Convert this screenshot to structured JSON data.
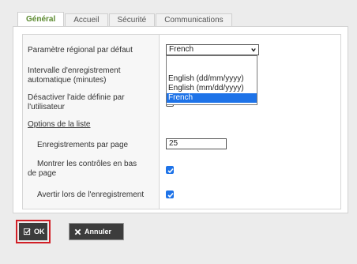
{
  "tabs": [
    {
      "label": "Général",
      "active": true
    },
    {
      "label": "Accueil",
      "active": false
    },
    {
      "label": "Sécurité",
      "active": false
    },
    {
      "label": "Communications",
      "active": false
    }
  ],
  "form": {
    "locale": {
      "label": "Paramètre régional par défaut",
      "value": "French",
      "options": [
        "English (dd/mm/yyyy)",
        "English (mm/dd/yyyy)",
        "French"
      ],
      "selected_option": "French"
    },
    "autosave": {
      "label_line1": "Intervalle d'enregistrement",
      "label_line2": "automatique (minutes)"
    },
    "disable_help": {
      "label_line1": "Désactiver l'aide définie par",
      "label_line2": "l'utilisateur",
      "checked": false
    },
    "list_options": {
      "title": "Options de la liste",
      "records_per_page": {
        "label": "Enregistrements par page",
        "value": "25"
      },
      "show_controls": {
        "label_line1": "Montrer les contrôles en bas",
        "label_line2": "de page",
        "checked": true
      },
      "warn_on_save": {
        "label": "Avertir lors de l'enregistrement",
        "checked": true
      }
    }
  },
  "buttons": {
    "ok": "OK",
    "cancel": "Annuler"
  },
  "colors": {
    "active_tab_text": "#5b8a2f",
    "selection": "#1e73e8",
    "ok_highlight": "#d11f26",
    "button_bg": "#3c3c3c"
  }
}
